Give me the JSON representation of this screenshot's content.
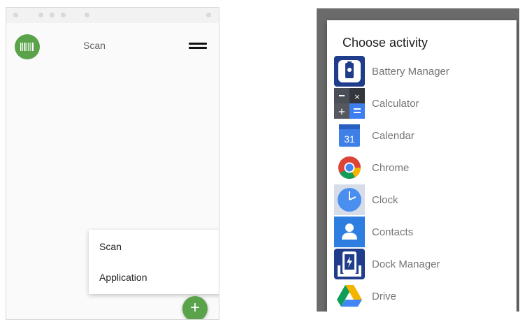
{
  "left_screen": {
    "title": "Scan",
    "popup_menu": {
      "items": [
        {
          "label": "Scan"
        },
        {
          "label": "Application"
        }
      ]
    },
    "fab_label": "+",
    "colors": {
      "accent": "#5aa34a"
    }
  },
  "right_screen": {
    "dialog_title": "Choose activity",
    "apps": [
      {
        "label": "Battery Manager",
        "icon": "battery-manager-icon"
      },
      {
        "label": "Calculator",
        "icon": "calculator-icon"
      },
      {
        "label": "Calendar",
        "icon": "calendar-icon",
        "icon_text": "31"
      },
      {
        "label": "Chrome",
        "icon": "chrome-icon"
      },
      {
        "label": "Clock",
        "icon": "clock-icon"
      },
      {
        "label": "Contacts",
        "icon": "contacts-icon"
      },
      {
        "label": "Dock Manager",
        "icon": "dock-manager-icon"
      },
      {
        "label": "Drive",
        "icon": "drive-icon"
      }
    ]
  }
}
